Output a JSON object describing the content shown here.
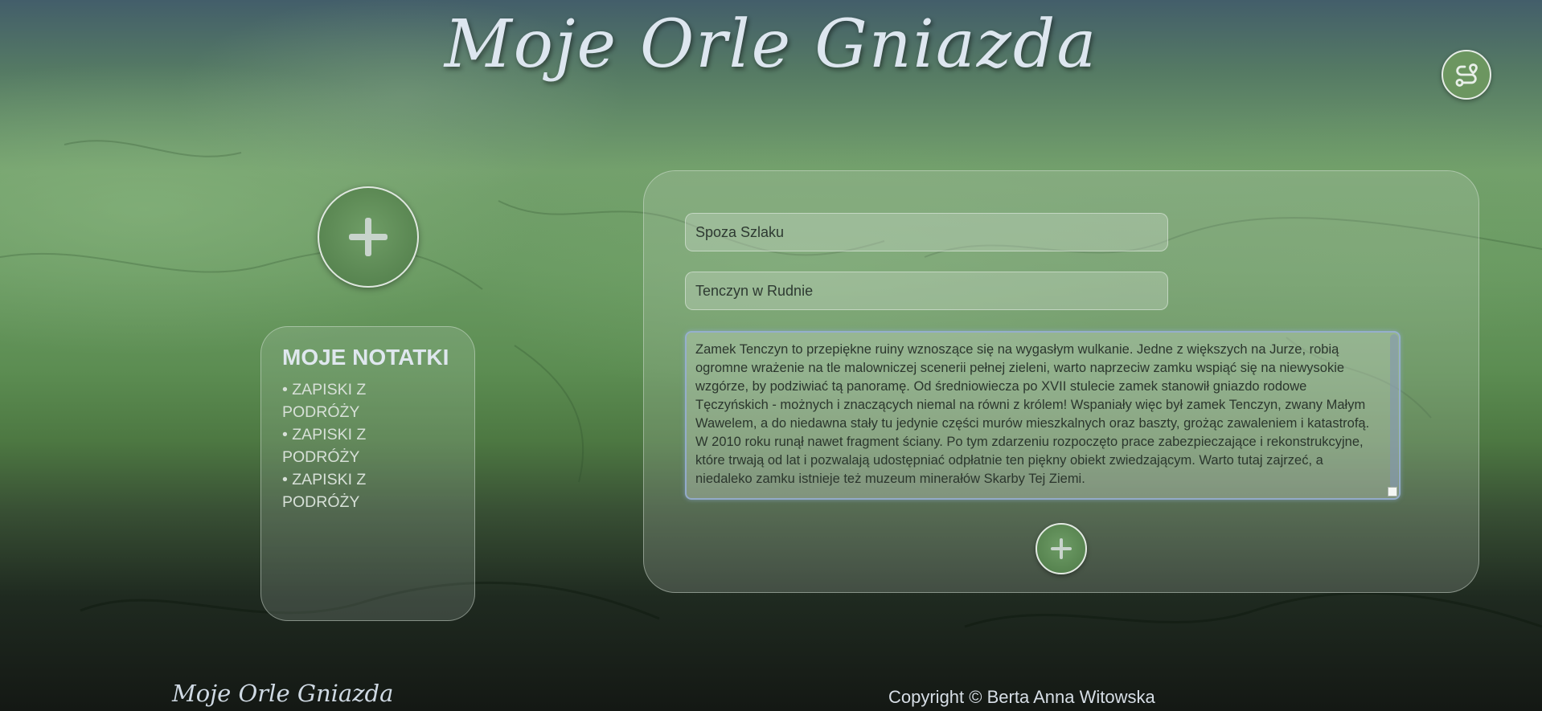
{
  "header": {
    "title": "Moje Orle Gniazda",
    "route_button_icon": "route-icon"
  },
  "sidebar": {
    "add_button_icon": "plus-icon",
    "notes_title": "MOJE NOTATKI",
    "notes_items": [
      "• ZAPISKI Z PODRÓŻY",
      "• ZAPISKI Z PODRÓŻY",
      "• ZAPISKI Z PODRÓŻY"
    ]
  },
  "form": {
    "category_value": "Spoza Szlaku",
    "place_value": "Tenczyn w Rudnie",
    "description_value": "Zamek Tenczyn to przepiękne ruiny wznoszące się na wygasłym wulkanie. Jedne z większych na Jurze, robią ogromne wrażenie na tle malowniczej scenerii pełnej zieleni, warto naprzeciw zamku wspiąć się na niewysokie wzgórze, by podziwiać tą panoramę. Od średniowiecza po XVII stulecie zamek stanowił gniazdo rodowe Tęczyńskich - możnych i znaczących niemal na równi z królem! Wspaniały więc był zamek Tenczyn, zwany Małym Wawelem, a do niedawna stały tu jedynie części murów mieszkalnych oraz baszty, grożąc zawaleniem i katastrofą. W 2010 roku runął nawet fragment ściany. Po tym zdarzeniu rozpoczęto prace zabezpieczające i rekonstrukcyjne, które trwają od lat i pozwalają udostępniać odpłatnie ten piękny obiekt zwiedzającym. Warto tutaj zajrzeć, a niedaleko zamku istnieje też muzeum minerałów Skarby Tej Ziemi.",
    "submit_icon": "plus-icon"
  },
  "footer": {
    "logo_text": "Moje Orle Gniazda",
    "copyright": "Copyright © Berta Anna Witowska"
  },
  "colors": {
    "accent_green": "#6c9660",
    "text_light": "#dfe7ee"
  }
}
